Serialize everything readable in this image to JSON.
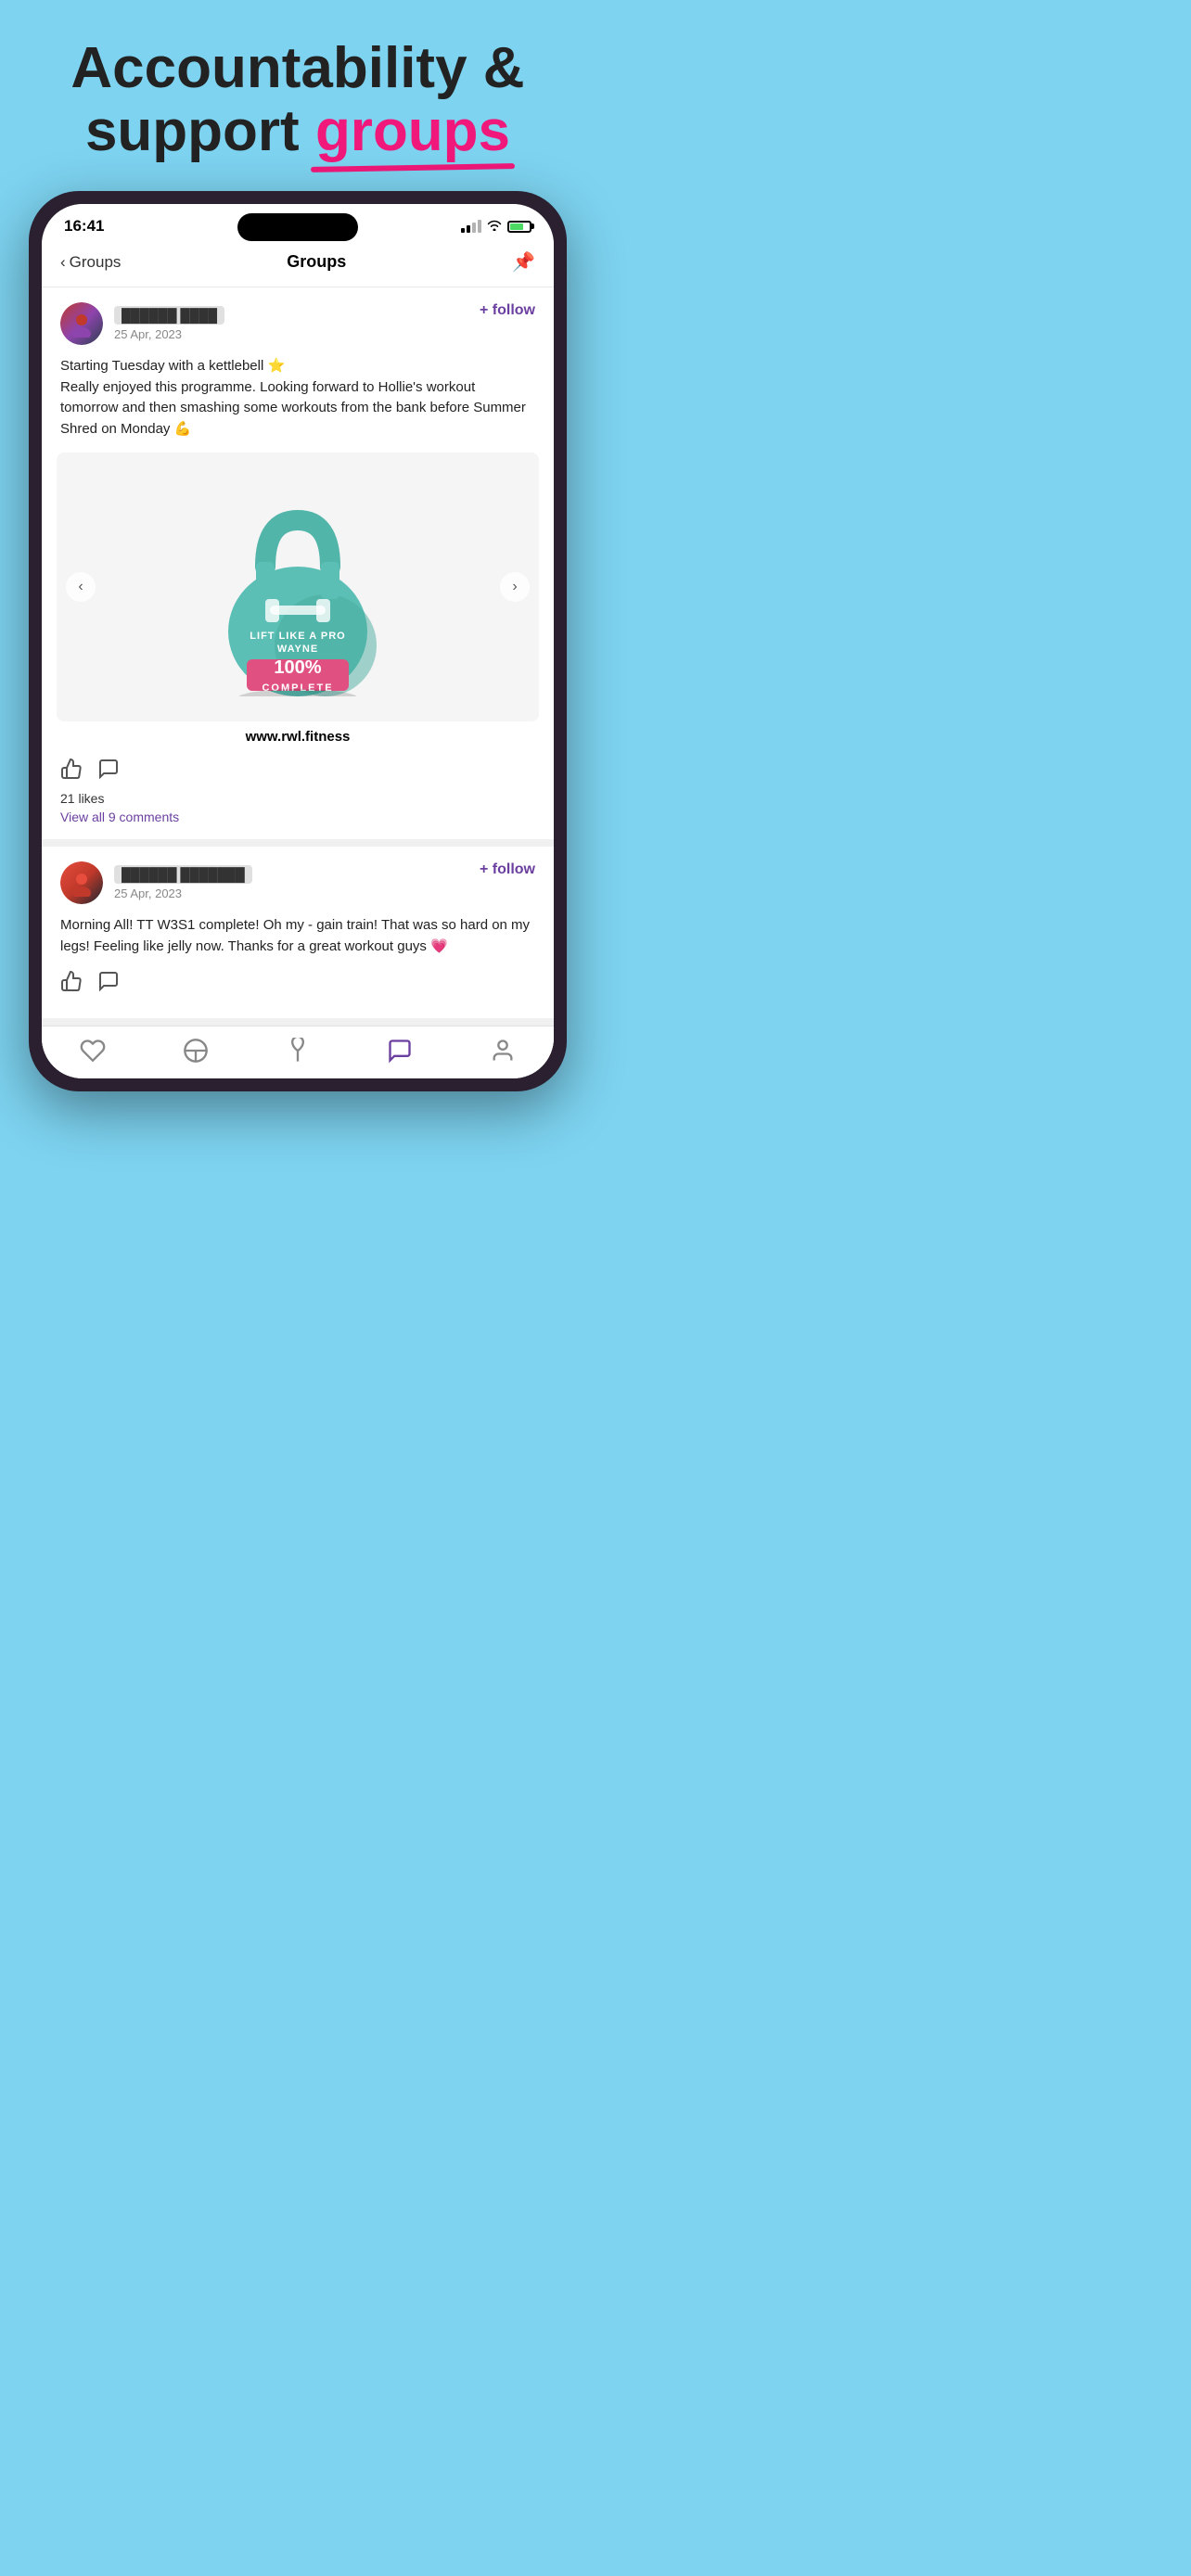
{
  "hero": {
    "line1": "Accountability &",
    "line2": "support ",
    "highlight": "groups"
  },
  "statusBar": {
    "time": "16:41",
    "battery": "70"
  },
  "navBar": {
    "backLabel": "Groups",
    "title": "Groups"
  },
  "posts": [
    {
      "id": "post1",
      "userName": "redacted user",
      "date": "25 Apr, 2023",
      "text": "Starting Tuesday with a kettlebell ⭐\nReally enjoyed this programme. Looking forward to Hollie's workout tomorrow and then smashing some workouts from the bank before Summer Shred on Monday 💪",
      "imageUrl": "www.rwl.fitness",
      "likes": "21 likes",
      "commentsLabel": "View all 9 comments",
      "followLabel": "+ follow"
    },
    {
      "id": "post2",
      "userName": "redacted user2",
      "date": "25 Apr, 2023",
      "text": "Morning All! TT W3S1 complete! Oh my - gain train! That was so hard on my legs! Feeling like jelly now. Thanks for a great workout guys 💗",
      "followLabel": "+ follow"
    }
  ],
  "bottomNav": {
    "items": [
      "heart",
      "bowl",
      "leaf",
      "chat-active",
      "person"
    ]
  }
}
